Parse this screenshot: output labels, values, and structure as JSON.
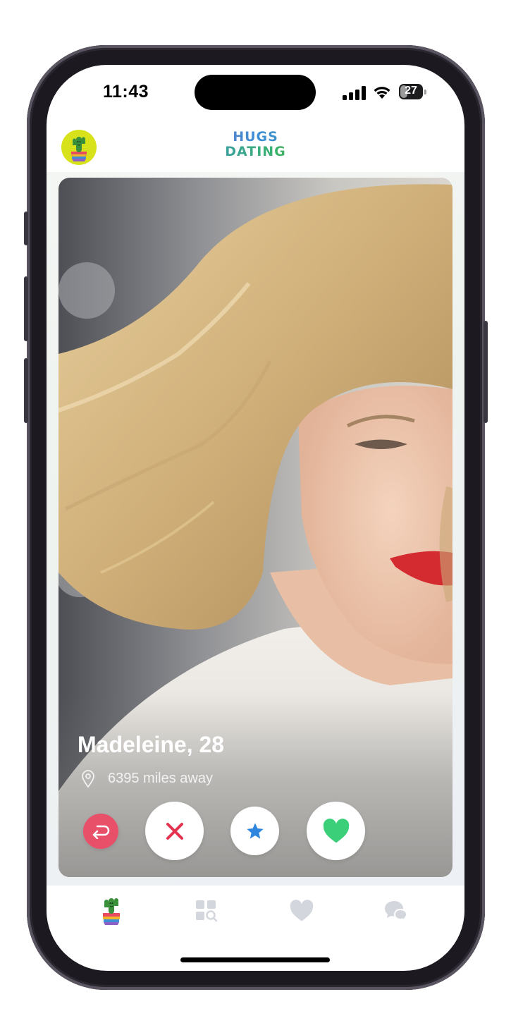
{
  "status_bar": {
    "time": "11:43",
    "battery": "27"
  },
  "header": {
    "logo_line1": "HUGS",
    "logo_line2": "DATING",
    "avatar_icon": "cactus-icon"
  },
  "profile": {
    "name": "Madeleine, 28",
    "distance": "6395 miles away",
    "location_icon": "location-pin-icon"
  },
  "actions": [
    {
      "name": "undo",
      "icon": "undo-icon",
      "color": "#e8506a"
    },
    {
      "name": "nope",
      "icon": "close-icon",
      "color": "#e3344f"
    },
    {
      "name": "super-like",
      "icon": "star-icon",
      "color": "#2e86de"
    },
    {
      "name": "like",
      "icon": "heart-icon",
      "color": "#3ccf7a"
    }
  ],
  "bottom_nav": [
    {
      "name": "discover",
      "icon": "cactus-icon",
      "active": true
    },
    {
      "name": "explore",
      "icon": "grid-search-icon",
      "active": false
    },
    {
      "name": "likes",
      "icon": "heart-icon",
      "active": false
    },
    {
      "name": "messages",
      "icon": "chat-bubbles-icon",
      "active": false
    }
  ],
  "colors": {
    "accent_red": "#e8506a",
    "like_green": "#3ccf7a",
    "star_blue": "#2e86de",
    "inactive_nav": "#d3d6dc"
  }
}
